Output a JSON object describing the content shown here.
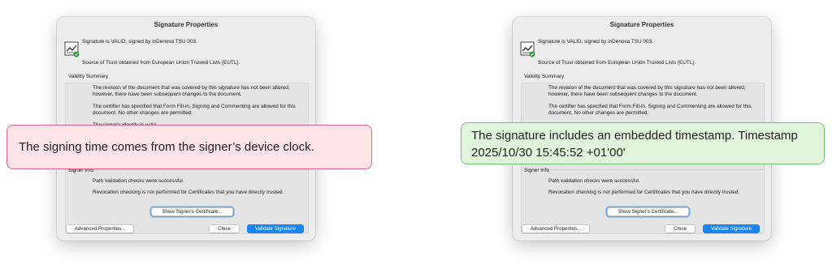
{
  "dialog": {
    "title": "Signature Properties",
    "status_text": "Signature is VALID, signed by inDenova TSU 003.",
    "trust_text": "Source of Trust obtained from European Union Trusted Lists (EUTL).",
    "validity_summary_label": "Validity Summary",
    "validity_lines": [
      "The revision of the document that was covered by this signature has not been altered; however, there have been subsequent changes to the document.",
      "The certifier has specified that Form Fill-in, Signing and Commenting are allowed for this document. No other changes are permitted.",
      "The signer's identity is valid."
    ],
    "signer_info_label": "Signer Info",
    "signer_lines": [
      "Path validation checks were successful.",
      "Revocation checking is not performed for Certificates that you have directly trusted."
    ],
    "show_cert_button": "Show Signer's Certificate...",
    "advanced_button": "Advanced Properties...",
    "close_button": "Close",
    "validate_button": "Validate Signature",
    "accent_color": "#1a84f0",
    "icon": "certified-signature-check-icon"
  },
  "callouts": {
    "left_text": "The signing time comes from the signer’s device clock.",
    "left_color": "#d9668a",
    "right_text": "The signature includes an embedded timestamp. Timestamp 2025/10/30 15:45:52 +01'00'",
    "right_color": "#6fc66a"
  }
}
